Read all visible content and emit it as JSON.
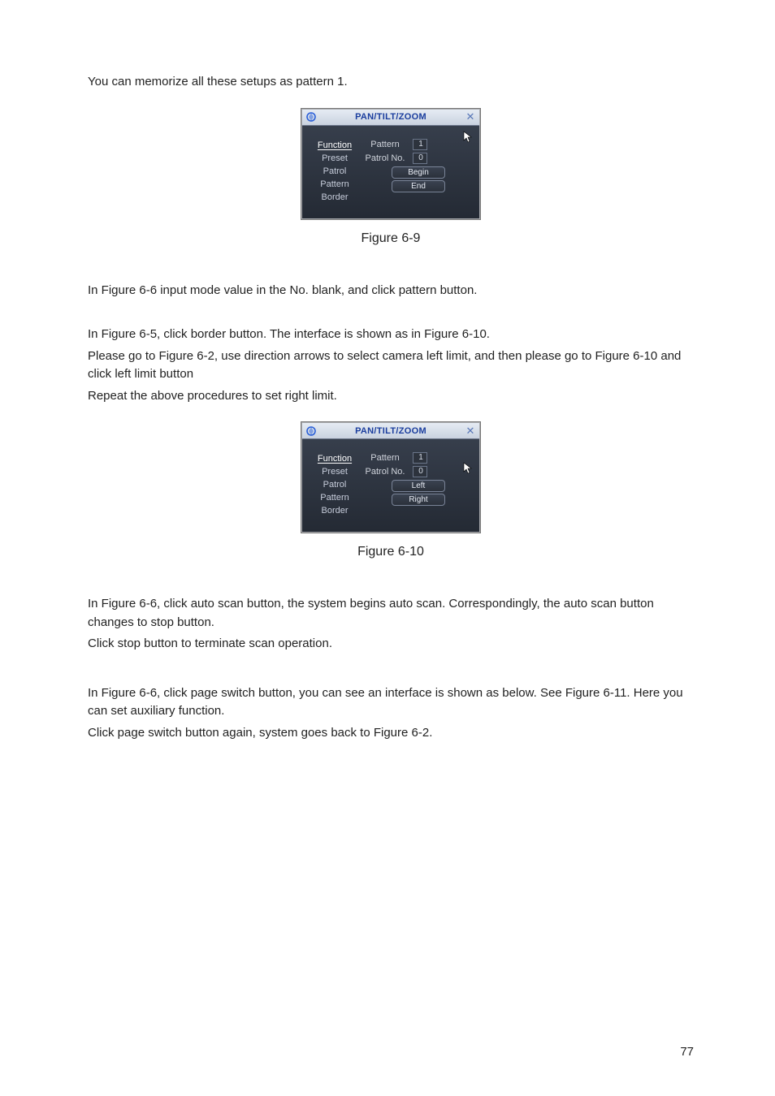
{
  "paragraphs": {
    "p1": "You can memorize all these setups as pattern 1.",
    "p2": "In Figure 6-6 input mode value in the No. blank, and click pattern button.",
    "p3": "In Figure 6-5, click border button. The interface is shown as in Figure 6-10.",
    "p4": "Please go to Figure 6-2, use direction arrows to select camera left limit, and then please go to Figure 6-10 and click left limit button",
    "p5": "Repeat the above procedures to set right limit.",
    "p6": "In Figure 6-6, click auto scan button, the system begins auto scan. Correspondingly, the auto scan button changes to stop button.",
    "p7": "Click stop button to terminate scan operation.",
    "p8": "In Figure 6-6, click page switch button, you can see an interface is shown as below. See Figure 6-11. Here you can set auxiliary function.",
    "p9": "Click page switch button again, system goes back to Figure 6-2."
  },
  "figures": {
    "fig1_caption": "Figure 6-9",
    "fig2_caption": "Figure 6-10"
  },
  "dialog": {
    "title": "PAN/TILT/ZOOM",
    "sidebar": {
      "function": "Function",
      "preset": "Preset",
      "patrol": "Patrol",
      "pattern": "Pattern",
      "border": "Border"
    },
    "labels": {
      "pattern": "Pattern",
      "patrol_no": "Patrol No."
    },
    "values": {
      "pattern": "1",
      "patrol_no": "0"
    },
    "buttons_a": {
      "begin": "Begin",
      "end": "End"
    },
    "buttons_b": {
      "left": "Left",
      "right": "Right"
    }
  },
  "page_number": "77"
}
